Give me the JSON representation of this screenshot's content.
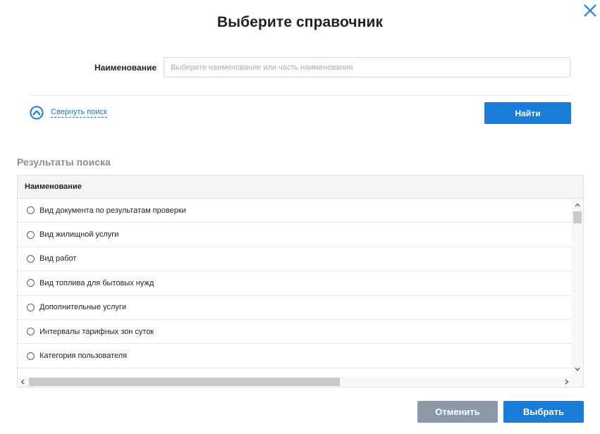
{
  "dialog": {
    "title": "Выберите справочник",
    "close_icon": "close-icon"
  },
  "search": {
    "name_label": "Наименование",
    "name_value": "",
    "name_placeholder": "Выберите наименование или часть наименования",
    "collapse_label": "Свернуть поиск",
    "collapse_icon": "chevron-up-circle-icon",
    "search_button": "Найти"
  },
  "results": {
    "heading": "Результаты поиска",
    "column_header": "Наименование",
    "rows": [
      "Вид документа по результатам проверки",
      "Вид жилищной услуги",
      "Вид работ",
      "Вид топлива для бытовых нужд",
      "Дополнительные услуги",
      "Интервалы тарифных зон суток",
      "Категория пользователя"
    ]
  },
  "footer": {
    "cancel_button": "Отменить",
    "select_button": "Выбрать"
  },
  "colors": {
    "accent": "#1a7cd6",
    "link": "#1e74c6",
    "secondary_button": "#8b98a5"
  }
}
